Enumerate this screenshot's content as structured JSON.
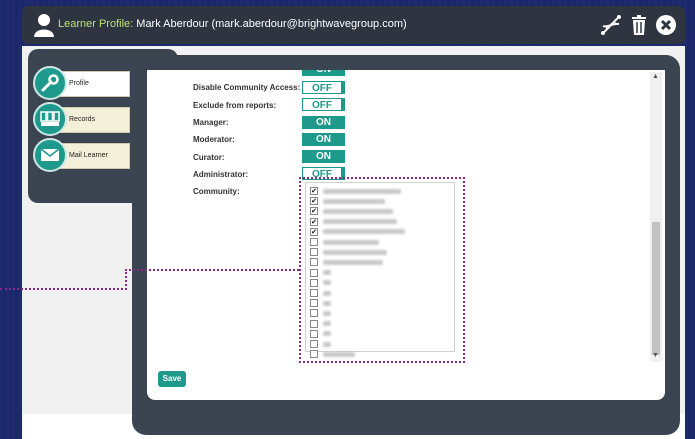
{
  "header": {
    "label": "Learner Profile:",
    "value": "Mark Aberdour (mark.aberdour@brightwavegroup.com)"
  },
  "nav": [
    {
      "label": "Profile",
      "icon": "wrench-icon",
      "active": true
    },
    {
      "label": "Records",
      "icon": "records-icon",
      "active": false
    },
    {
      "label": "Mail Learner",
      "icon": "mail-icon",
      "active": false
    }
  ],
  "fields": [
    {
      "label": "Disable Community Access:",
      "state": "OFF"
    },
    {
      "label": "Exclude from reports:",
      "state": "OFF"
    },
    {
      "label": "Manager:",
      "state": "ON"
    },
    {
      "label": "Moderator:",
      "state": "ON"
    },
    {
      "label": "Curator:",
      "state": "ON"
    },
    {
      "label": "Administrator:",
      "state": "OFF"
    }
  ],
  "partial_toggle": "ON",
  "community": {
    "label": "Community:",
    "checked": [
      true,
      true,
      true,
      true,
      true,
      false,
      false,
      false,
      false,
      false,
      false,
      false,
      false,
      false,
      false,
      false,
      false,
      false
    ]
  },
  "save_label": "Save",
  "colors": {
    "accent": "#1e9a8d",
    "panel": "#3b4451",
    "highlight": "#8b2a8b"
  }
}
